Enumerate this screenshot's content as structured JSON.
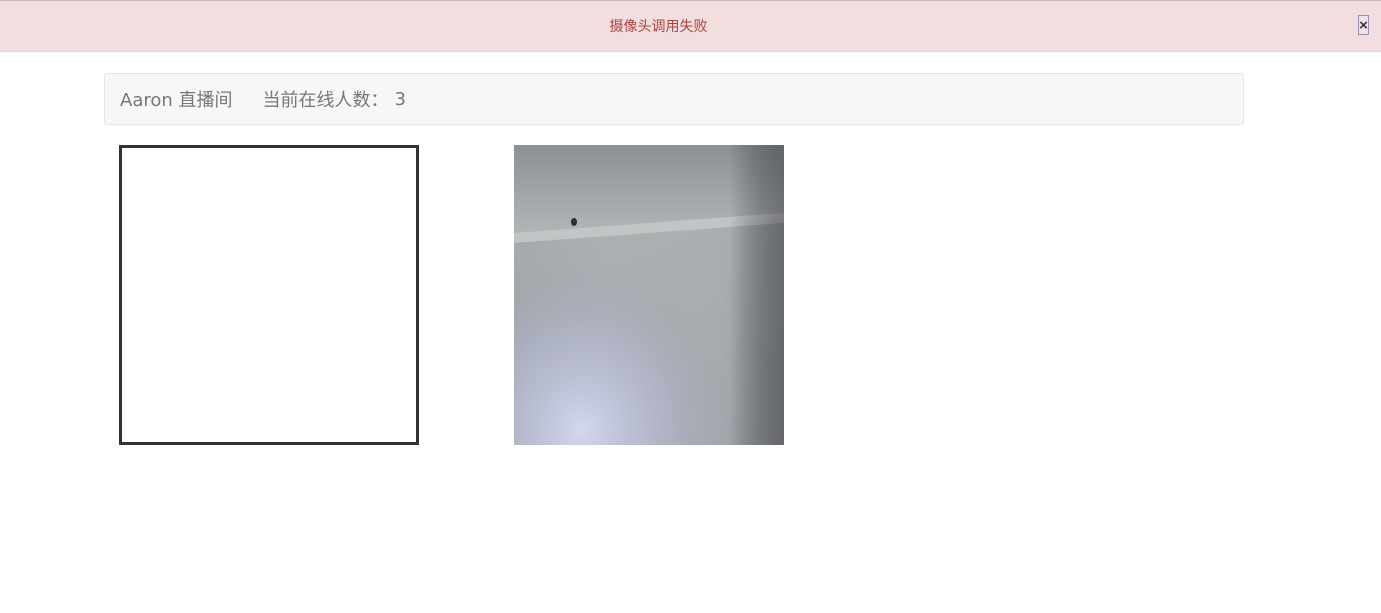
{
  "alert": {
    "message": "摄像头调用失败",
    "close_label": "×"
  },
  "header": {
    "room_name": "Aaron 直播间",
    "online_label": "当前在线人数：",
    "online_count": "3"
  },
  "videos": {
    "local": {
      "icon": "video-frame-empty"
    },
    "remote": {
      "icon": "webcam-feed"
    }
  },
  "colors": {
    "alert_bg": "#f2dede",
    "alert_text": "#a94442",
    "panel_bg": "#f7f7f7",
    "panel_text": "#777777",
    "video_border": "#333333"
  }
}
